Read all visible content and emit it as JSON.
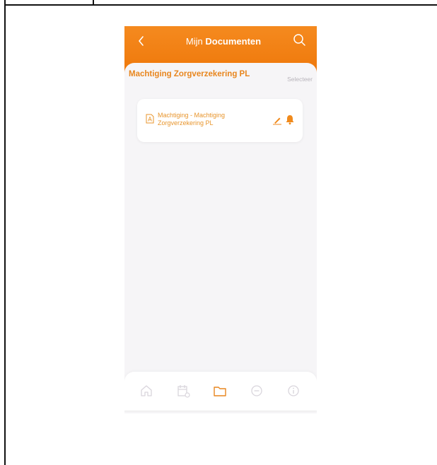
{
  "app": {
    "title_prefix": "Mijn",
    "title_bold": "Documenten"
  },
  "folder": {
    "title": "Machtiging Zorgverzekering PL",
    "select_label": "Selecteer"
  },
  "documents": [
    {
      "name": "Machtiging - Machtiging Zorgverzekering PL",
      "icon": "pdf-icon"
    }
  ],
  "nav": {
    "items": [
      {
        "name": "home",
        "icon": "home-icon"
      },
      {
        "name": "calendar",
        "icon": "calendar-icon"
      },
      {
        "name": "documents",
        "icon": "folder-icon",
        "active": true
      },
      {
        "name": "messages",
        "icon": "chat-icon"
      },
      {
        "name": "info",
        "icon": "info-icon"
      }
    ]
  },
  "colors": {
    "brand_orange": "#f07c0f",
    "text_orange": "#e8861e",
    "icon_orange": "#f08a1c",
    "background": "#f6f5f7"
  }
}
